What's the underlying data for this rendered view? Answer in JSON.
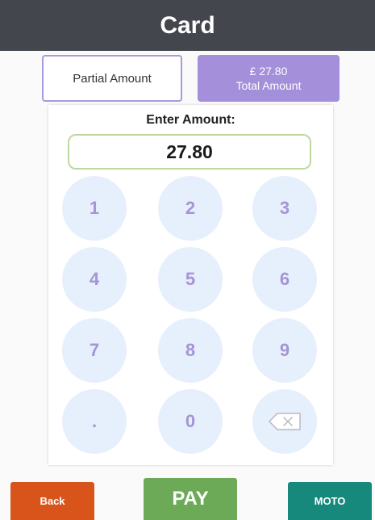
{
  "header": {
    "title": "Card"
  },
  "amount_options": {
    "partial_label": "Partial Amount",
    "total_value": "£ 27.80",
    "total_label": "Total Amount"
  },
  "keypad": {
    "prompt": "Enter Amount:",
    "amount_value": "27.80",
    "keys": [
      "1",
      "2",
      "3",
      "4",
      "5",
      "6",
      "7",
      "8",
      "9",
      ".",
      "0"
    ],
    "backspace_icon": "backspace-icon"
  },
  "footer": {
    "back_label": "Back",
    "pay_label": "PAY",
    "moto_label": "MOTO"
  },
  "colors": {
    "header_bg": "#43464c",
    "accent_purple": "#a48fdb",
    "key_bg": "#e6effc",
    "key_text": "#a594d6",
    "input_border": "#bcd9a2",
    "back_bg": "#d9541b",
    "pay_bg": "#6daa58",
    "moto_bg": "#17897c"
  }
}
